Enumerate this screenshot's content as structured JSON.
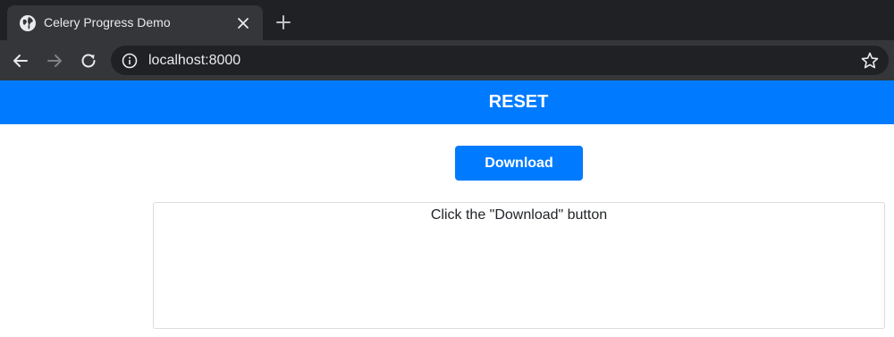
{
  "browser": {
    "tab": {
      "title": "Celery Progress Demo",
      "favicon": "globe-icon",
      "close_icon": "close-icon"
    },
    "new_tab_icon": "plus-icon",
    "nav": {
      "back_icon": "arrow-left-icon",
      "forward_icon": "arrow-right-icon",
      "reload_icon": "reload-icon"
    },
    "address_bar": {
      "url": "localhost:8000",
      "info_icon": "info-icon",
      "bookmark_icon": "star-icon"
    }
  },
  "page": {
    "reset_label": "RESET",
    "download_label": "Download",
    "status_message": "Click the \"Download\" button"
  },
  "colors": {
    "primary": "#007bff",
    "chrome_dark": "#202124",
    "chrome_tab": "#35363a",
    "chrome_text": "#e8eaed"
  }
}
